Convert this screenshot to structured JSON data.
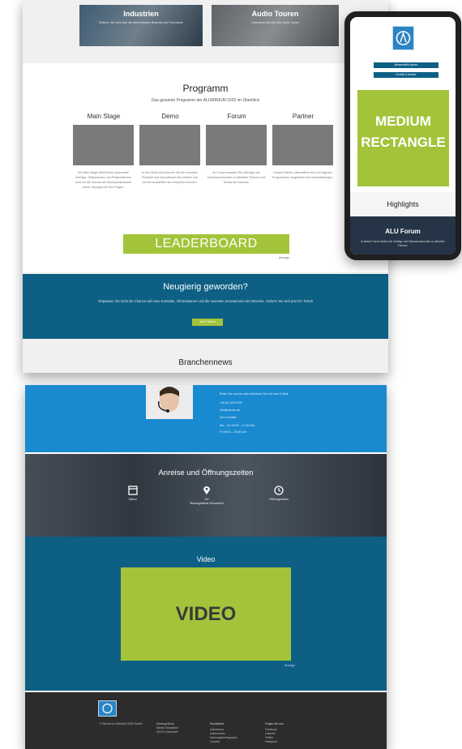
{
  "desktop_top": {
    "hero_cards": [
      {
        "title": "Industrien",
        "subtitle": "Erfahren Sie mehr über die teilnehmenden Branchen der Fachmesse"
      },
      {
        "title": "Audio Touren",
        "subtitle": "Informieren Sie sich über Audio Touren"
      }
    ],
    "program": {
      "title": "Programm",
      "subtitle": "Das gesamte Programm der ALUMINIUM 2020 im Überblick",
      "columns": [
        {
          "heading": "Main Stage",
          "text": "Die Main Stage bietet Ihnen spannende Vorträge, Diskussionen und Präsentationen rund um die Zukunft der Aluminiumindustrie sowie Lösungen für Ihre Fragen."
        },
        {
          "heading": "Demo",
          "text": "In der Demo Area können Sie die neuesten Produkte und Innovationen live erleben und mit den Ausstellern ins Gespräch kommen."
        },
        {
          "heading": "Forum",
          "text": "Im Forum erwarten Sie Vorträge und Diskussionsrunden zu aktuellen Themen und Trends der Branche."
        },
        {
          "heading": "Partner",
          "text": "Unsere Partner präsentieren sich mit eigenen Programmen, Angeboten und Veranstaltungen."
        }
      ]
    },
    "leaderboard": "LEADERBOARD",
    "ad_label": "Anzeige",
    "curious": {
      "title": "Neugierig geworden?",
      "text": "Verpassen Sie nicht die Chance auf neue Kontakte, Informationen und die neuesten Innovationen der Branche. Sichern Sie sich jetzt Ihr Ticket!",
      "button": "Jetzt Tickets"
    },
    "branch_news": "Branchennews"
  },
  "phone": {
    "buttons": [
      "Messeauftritt planen",
      "Kontakt & Anreise"
    ],
    "medium_rectangle_line1": "MEDIUM",
    "medium_rectangle_line2": "RECTANGLE",
    "highlights": "Highlights",
    "alu_forum": {
      "title": "ALU Forum",
      "subtitle": "In diesem Forum finden Sie Vorträge und Diskussionsrunden zu aktuellen Themen."
    }
  },
  "desktop_bottom": {
    "contact_lines": [
      "Rufen Sie uns an oder schreiben Sie uns eine E-Mail",
      "+49 (0) 0000 000",
      "info@messe.de",
      "Zum Kontakt",
      "Mo – Do 09:00 – 17:00 Uhr",
      "Fr 09:00 – 15:00 Uhr"
    ],
    "travel": {
      "title": "Anreise und Öffnungszeiten",
      "items": [
        {
          "icon": "calendar-icon",
          "label": "Datum"
        },
        {
          "icon": "location-pin-icon",
          "label": "Ort\nMessegelände Düsseldorf"
        },
        {
          "icon": "clock-icon",
          "label": "Öffnungszeiten"
        }
      ]
    },
    "video": {
      "title": "Video",
      "placeholder": "VIDEO",
      "ad_label": "Anzeige"
    },
    "footer": {
      "col1": "© Messe ALUMINIUM 2020 GmbH",
      "col2": "Messegelände\nMesse Düsseldorf\n40474 Düsseldorf",
      "col3_title": "Rechtliches",
      "col3": "Impressum\nDatenschutz\nNutzungsbedingungen\nCookies",
      "col4_title": "Folgen Sie uns",
      "col4": "Facebook\nLinkedIn\nTwitter\nInstagram"
    }
  },
  "colors": {
    "brand_blue": "#0d5f84",
    "accent_green": "#a3c43a",
    "contact_blue": "#1a8ad0",
    "footer": "#2c2c2c"
  }
}
